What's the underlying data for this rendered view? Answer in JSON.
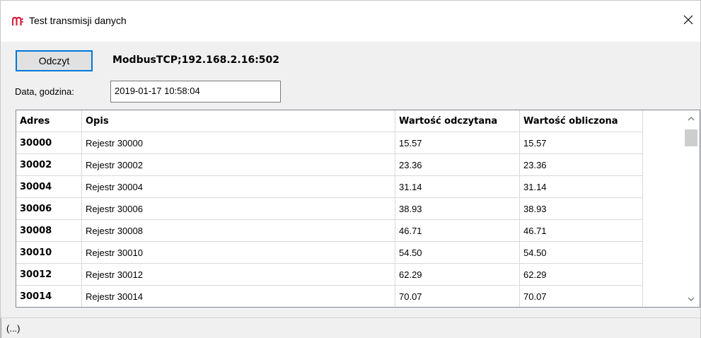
{
  "window": {
    "title": "Test transmisji danych",
    "accent_color": "#d4213d"
  },
  "toolbar": {
    "read_label": "Odczyt",
    "connection": "ModbusTCP;192.168.2.16:502"
  },
  "datetime": {
    "label": "Data, godzina:",
    "value": "2019-01-17 10:58:04"
  },
  "table": {
    "headers": [
      "Adres",
      "Opis",
      "Wartość odczytana",
      "Wartość obliczona"
    ],
    "rows": [
      [
        "30000",
        "Rejestr 30000",
        "15.57",
        "15.57"
      ],
      [
        "30002",
        "Rejestr 30002",
        "23.36",
        "23.36"
      ],
      [
        "30004",
        "Rejestr 30004",
        "31.14",
        "31.14"
      ],
      [
        "30006",
        "Rejestr 30006",
        "38.93",
        "38.93"
      ],
      [
        "30008",
        "Rejestr 30008",
        "46.71",
        "46.71"
      ],
      [
        "30010",
        "Rejestr 30010",
        "54.50",
        "54.50"
      ],
      [
        "30012",
        "Rejestr 30012",
        "62.29",
        "62.29"
      ],
      [
        "30014",
        "Rejestr 30014",
        "70.07",
        "70.07"
      ]
    ]
  },
  "status": {
    "text": "(...)"
  }
}
